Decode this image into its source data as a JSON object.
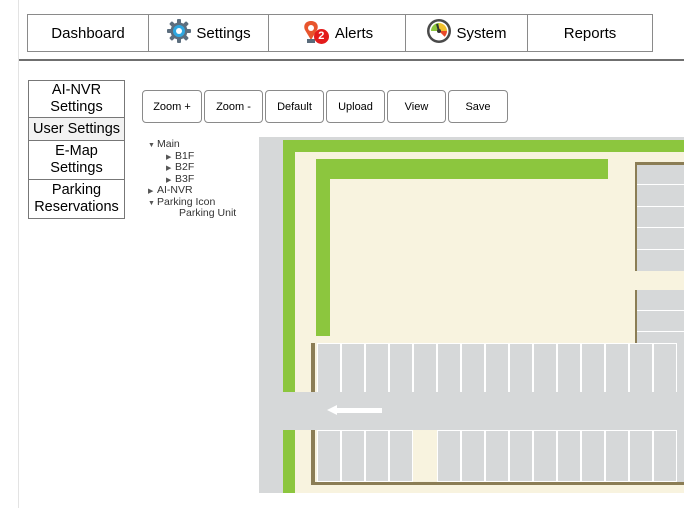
{
  "nav": {
    "tabs": [
      {
        "label": "Dashboard",
        "icon": ""
      },
      {
        "label": "Settings",
        "icon": "gear-icon"
      },
      {
        "label": "Alerts",
        "icon": "alert-pin-icon",
        "badge": "2"
      },
      {
        "label": "System",
        "icon": "gauge-icon"
      },
      {
        "label": "Reports",
        "icon": ""
      }
    ]
  },
  "left_menu": [
    {
      "label": "AI-NVR Settings"
    },
    {
      "label": "User Settings"
    },
    {
      "label": "E-Map Settings"
    },
    {
      "label": "Parking Reservations"
    }
  ],
  "toolbar": {
    "buttons": [
      "Zoom +",
      "Zoom -",
      "Default",
      "Upload",
      "View",
      "Save"
    ]
  },
  "tree": {
    "main": "Main",
    "b1f": "B1F",
    "b2f": "B2F",
    "b3f": "B3F",
    "ainvr": "AI-NVR",
    "parking_icon": "Parking Icon",
    "parking_unit": "Parking Unit"
  },
  "colors": {
    "accent_green": "#8cc63e",
    "floor_cream": "#f8f3df",
    "road_gray": "#d6d8d9",
    "border_brown": "#8b7d55",
    "badge_red": "#e31b1b"
  }
}
